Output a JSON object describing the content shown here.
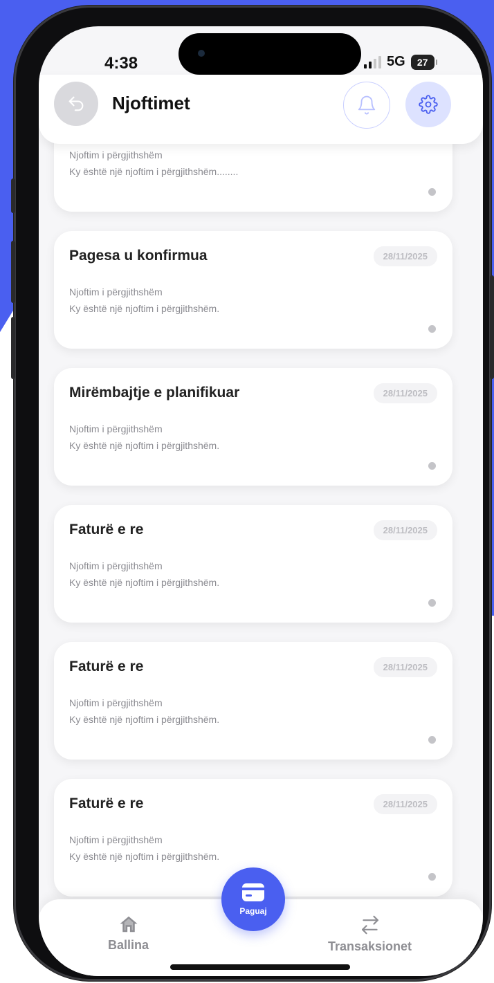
{
  "status_bar": {
    "time": "4:38",
    "network": "5G",
    "battery": "27"
  },
  "header": {
    "title": "Njoftimet"
  },
  "partial_card": {
    "category": "Njoftim i përgjithshëm",
    "body": "Ky është një njoftim i përgjithshëm........"
  },
  "notifications": [
    {
      "title": "Pagesa u konfirmua",
      "date": "28/11/2025",
      "category": "Njoftim i përgjithshëm",
      "body": "Ky është një njoftim i përgjithshëm."
    },
    {
      "title": "Mirëmbajtje e planifikuar",
      "date": "28/11/2025",
      "category": "Njoftim i përgjithshëm",
      "body": "Ky është një njoftim i përgjithshëm."
    },
    {
      "title": "Faturë e re",
      "date": "28/11/2025",
      "category": "Njoftim i përgjithshëm",
      "body": "Ky është një njoftim i përgjithshëm."
    },
    {
      "title": "Faturë e re",
      "date": "28/11/2025",
      "category": "Njoftim i përgjithshëm",
      "body": "Ky është një njoftim i përgjithshëm."
    },
    {
      "title": "Faturë e re",
      "date": "28/11/2025",
      "category": "Njoftim i përgjithshëm",
      "body": "Ky është një njoftim i përgjithshëm."
    }
  ],
  "bottom_nav": {
    "home_label": "Ballina",
    "pay_label": "Paguaj",
    "transactions_label": "Transaksionet"
  },
  "colors": {
    "accent": "#4a5ff0",
    "accent_light": "#dde2ff"
  },
  "icons": [
    "back-arrow-icon",
    "bell-icon",
    "gear-icon",
    "home-icon",
    "card-icon",
    "transfer-icon"
  ]
}
